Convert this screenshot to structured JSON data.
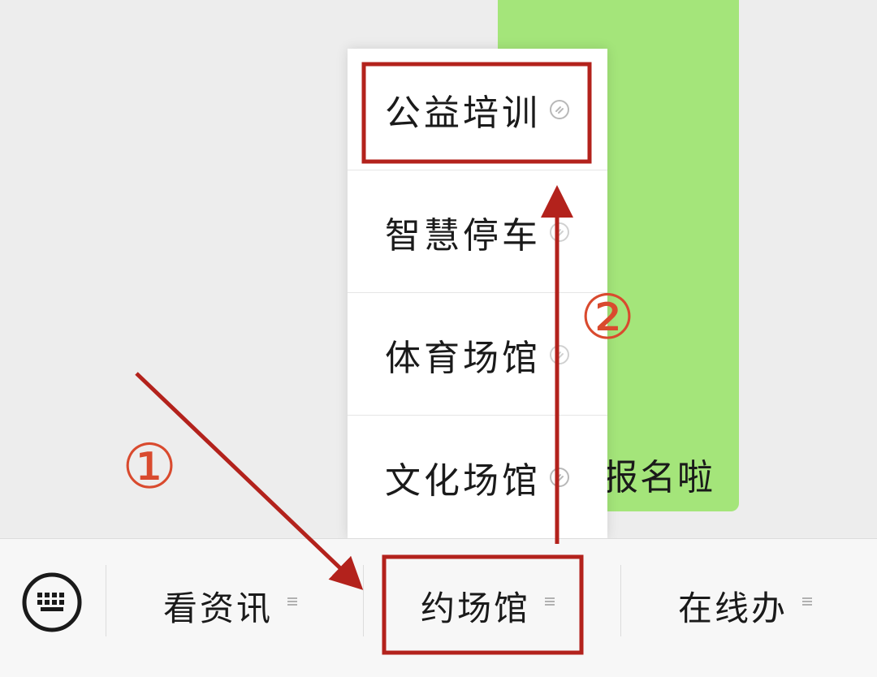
{
  "chat": {
    "bubble_text": "报名啦"
  },
  "popup_menu": {
    "items": [
      {
        "label": "公益培训",
        "icon": "mini-program-link-icon"
      },
      {
        "label": "智慧停车",
        "icon": "mini-program-link-icon"
      },
      {
        "label": "体育场馆",
        "icon": "mini-program-link-icon"
      },
      {
        "label": "文化场馆",
        "icon": "mini-program-link-icon"
      }
    ]
  },
  "bottom_bar": {
    "keyboard_icon": "keyboard-icon",
    "menus": [
      {
        "label": "看资讯",
        "icon": "menu-lines-icon"
      },
      {
        "label": "约场馆",
        "icon": "menu-lines-icon"
      },
      {
        "label": "在线办",
        "icon": "menu-lines-icon"
      }
    ]
  },
  "annotations": {
    "step1": "①",
    "step2": "②",
    "color": "#b3221c"
  }
}
